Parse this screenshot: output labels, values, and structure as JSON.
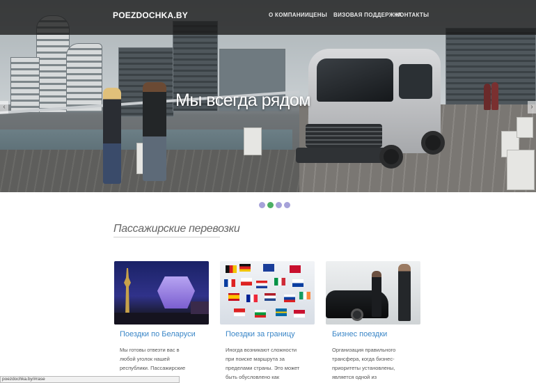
{
  "navbar": {
    "brand": "POEZDOCHKA.BY",
    "items": [
      "О КОМПАНИИ",
      "ЦЕНЫ",
      "ВИЗОВАЯ ПОДДЕРЖКА",
      "КОНТАКТЫ"
    ]
  },
  "hero": {
    "slogan": "Мы всегда рядом",
    "slides_total": 4,
    "active_slide": 2
  },
  "section": {
    "title": "Пассажирские перевозки"
  },
  "cards": [
    {
      "title": "Поездки по Беларуси",
      "text": "Мы готовы отвезти вас в любой уголок нашей республики. Пассажирские перевозки еще"
    },
    {
      "title": "Поездки за границу",
      "text": "Иногда возникают сложности при поиске маршрута за пределами страны. Это может быть обусловлено как языковым барьером, другой"
    },
    {
      "title": "Бизнес поездки",
      "text": "Организация правильного трансфера, когда бизнес-приоритеты установлены, является одной из составляющих успешной"
    }
  ],
  "statusbar": {
    "url": "poezdochka.by/#rase"
  }
}
